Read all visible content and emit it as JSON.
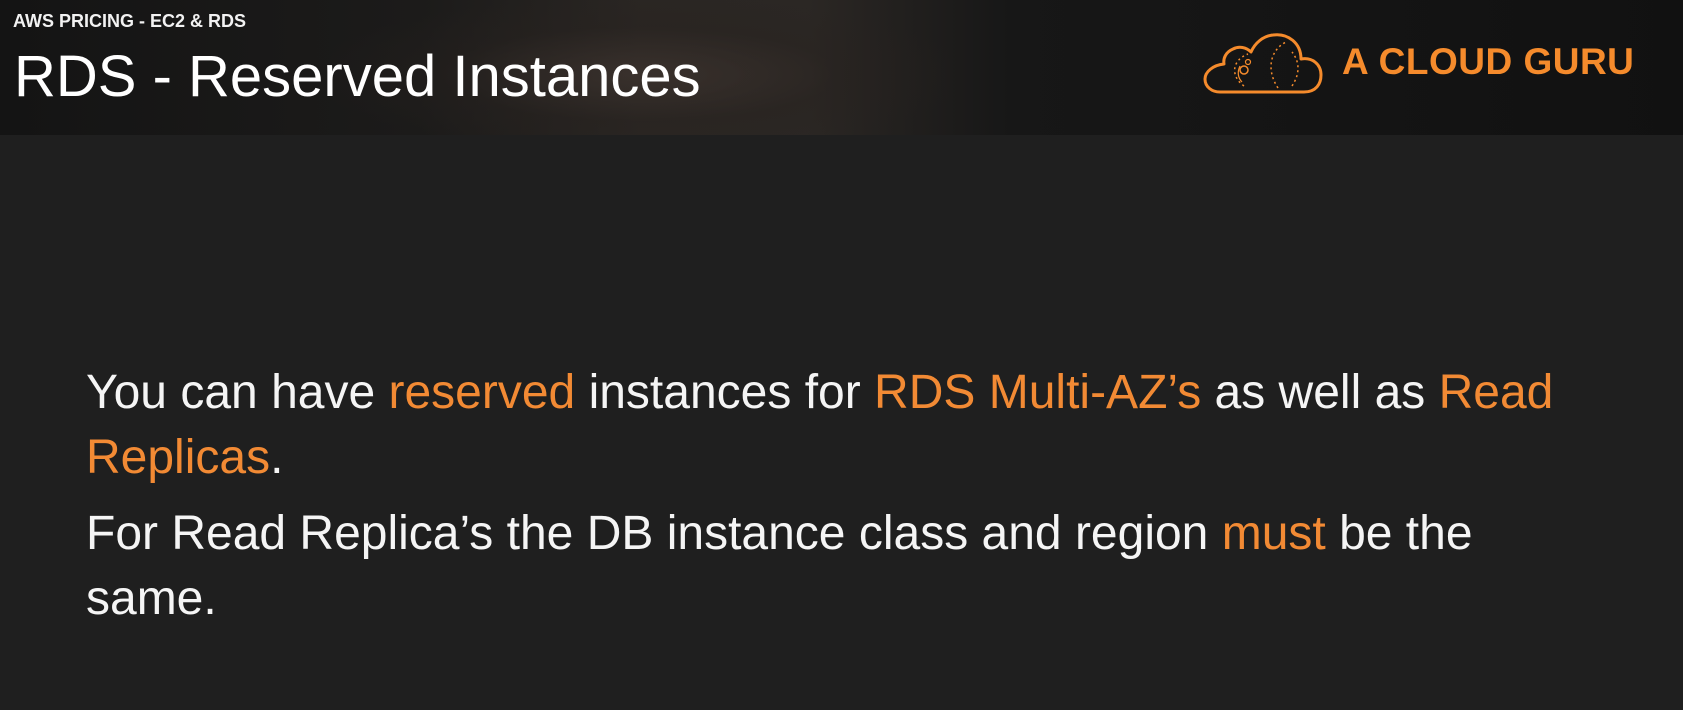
{
  "header": {
    "kicker": "AWS PRICING - EC2 & RDS",
    "title": "RDS - Reserved Instances",
    "logo": {
      "icon": "cloud-icon",
      "text": "A CLOUD GURU"
    }
  },
  "colors": {
    "accent": "#f28a34",
    "text": "#f5f5f5",
    "background": "#1f1f1f"
  },
  "paragraph1": {
    "t1": "You can have ",
    "h1": "reserved",
    "t2": " instances for ",
    "h2": "RDS Multi-AZ’s",
    "t3": " as well as ",
    "h3": "Read Replicas",
    "t4": "."
  },
  "paragraph2": {
    "t1": "For Read Replica’s the DB instance class and region ",
    "h1": "must",
    "t2": " be the same."
  }
}
